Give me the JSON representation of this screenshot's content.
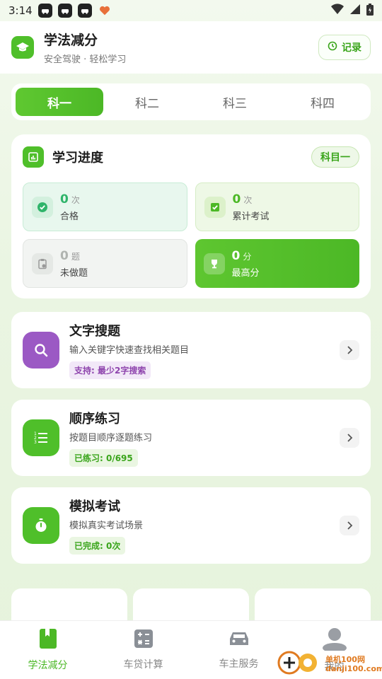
{
  "status_bar": {
    "time": "3:14",
    "notification_icons": [
      "car-app-icon",
      "car-app-icon",
      "car-app-icon",
      "heart-app-icon"
    ],
    "right_icons": [
      "wifi-icon",
      "signal-icon",
      "battery-icon"
    ]
  },
  "header": {
    "title": "学法减分",
    "subtitle": "安全驾驶 · 轻松学习",
    "record_label": "记录"
  },
  "tabs": [
    {
      "label": "科一",
      "active": true
    },
    {
      "label": "科二",
      "active": false
    },
    {
      "label": "科三",
      "active": false
    },
    {
      "label": "科四",
      "active": false
    }
  ],
  "progress": {
    "title": "学习进度",
    "subject_badge": "科目一",
    "stats": {
      "pass": {
        "value": "0",
        "unit": "次",
        "label": "合格"
      },
      "total": {
        "value": "0",
        "unit": "次",
        "label": "累计考试"
      },
      "todo": {
        "value": "0",
        "unit": "题",
        "label": "未做题"
      },
      "best": {
        "value": "0",
        "unit": "分",
        "label": "最高分"
      }
    }
  },
  "features": [
    {
      "title": "文字搜题",
      "desc": "输入关键字快速查找相关题目",
      "tag": "支持: 最少2字搜索",
      "icon": "search-icon",
      "color": "#9b59c4"
    },
    {
      "title": "顺序练习",
      "desc": "按题目顺序逐题练习",
      "tag": "已练习: 0/695",
      "icon": "list-icon",
      "color": "#4fbf2a"
    },
    {
      "title": "模拟考试",
      "desc": "模拟真实考试场景",
      "tag": "已完成: 0次",
      "icon": "stopwatch-icon",
      "color": "#4fbf2a"
    }
  ],
  "bottom_nav": [
    {
      "label": "学法减分",
      "icon": "book-icon",
      "active": true
    },
    {
      "label": "车贷计算",
      "icon": "calculator-icon",
      "active": false
    },
    {
      "label": "车主服务",
      "icon": "car-icon",
      "active": false
    },
    {
      "label": "我的",
      "icon": "user-icon",
      "active": false
    }
  ],
  "watermark": {
    "line1": "单机100网",
    "line2": "danji100.com"
  },
  "colors": {
    "accent": "#4fbf2a",
    "purple": "#9b59c4"
  }
}
